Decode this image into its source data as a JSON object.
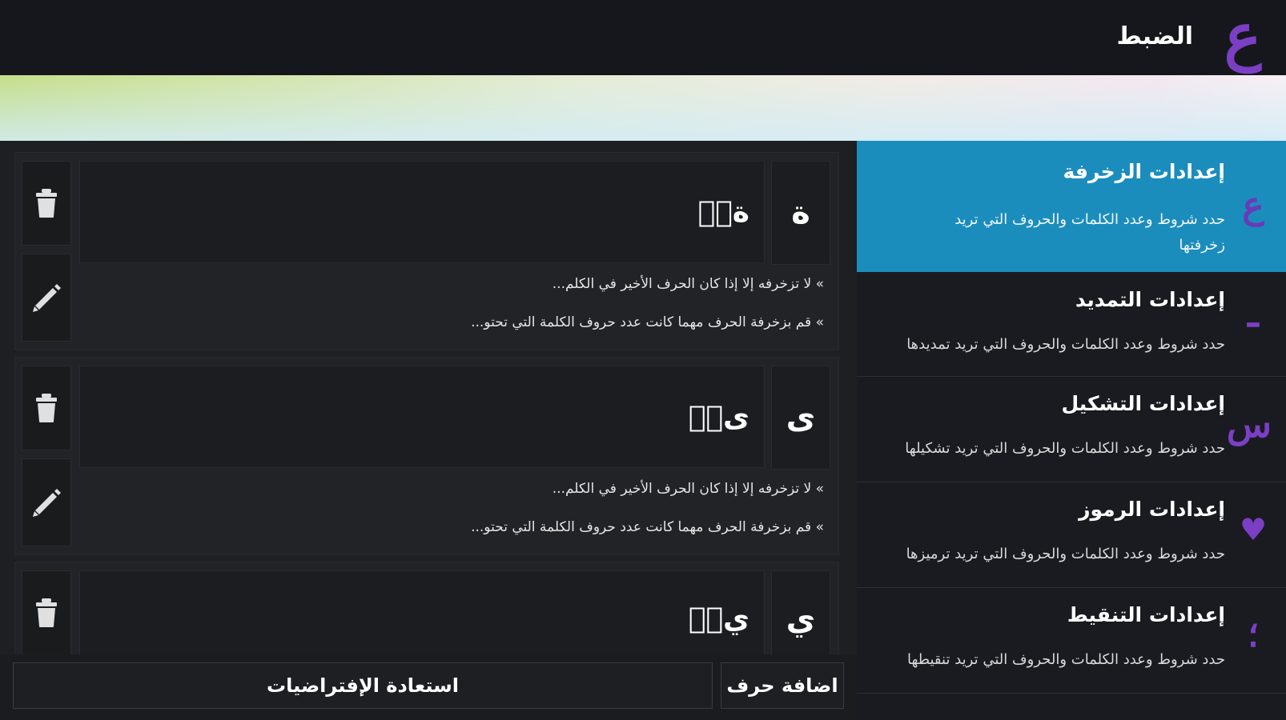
{
  "header": {
    "logo_glyph": "ع",
    "title": "الضبط"
  },
  "sidebar": {
    "items": [
      {
        "icon": "zakhrafa-ain-icon",
        "icon_glyph": "ع",
        "title": "إعدادات الزخرفة",
        "desc_line1": "حدد شروط وعدد الكلمات والحروف التي تريد",
        "desc_line2": "زخرفتها",
        "active": true
      },
      {
        "icon": "tamdeed-icon",
        "icon_glyph": "ـ",
        "title": "إعدادات التمديد",
        "desc_line1": "حدد شروط وعدد الكلمات والحروف التي تريد تمديدها",
        "desc_line2": ""
      },
      {
        "icon": "tashkeel-icon",
        "icon_glyph": "س",
        "title": "إعدادات التشكيل",
        "desc_line1": "حدد شروط وعدد الكلمات والحروف التي تريد تشكيلها",
        "desc_line2": ""
      },
      {
        "icon": "heart-icon",
        "icon_glyph": "♥",
        "title": "إعدادات الرموز",
        "desc_line1": "حدد شروط وعدد الكلمات والحروف التي تريد ترميزها",
        "desc_line2": ""
      },
      {
        "icon": "tangheet-icon",
        "icon_glyph": "؛",
        "title": "إعدادات التنقيط",
        "desc_line1": "حدد شروط وعدد الكلمات والحروف التي تريد تنقيطها",
        "desc_line2": ""
      }
    ]
  },
  "letters": [
    {
      "letter": "ة",
      "variant": "ةۣۛ",
      "rule1": "» لا تزخرفه إلا إذا كان الحرف الأخير في الكلم...",
      "rule2": "» قم بزخرفة الحرف مهما كانت عدد حروف الكلمة التي تحتو..."
    },
    {
      "letter": "ى",
      "variant": "ىۣۛ",
      "rule1": "» لا تزخرفه إلا إذا كان الحرف الأخير في الكلم...",
      "rule2": "» قم بزخرفة الحرف مهما كانت عدد حروف الكلمة التي تحتو..."
    },
    {
      "letter": "ي",
      "variant": "يۣۛ",
      "rule1": "",
      "rule2": ""
    }
  ],
  "icons": {
    "delete": "trash-icon",
    "edit": "pencil-icon"
  },
  "footer": {
    "add_letter": "اضافة حرف",
    "restore_defaults": "استعادة الإفتراضيات"
  },
  "colors": {
    "accent_blue": "#1b8dbd",
    "brand_purple": "#7b3fc4",
    "background": "#1c1c1e"
  }
}
